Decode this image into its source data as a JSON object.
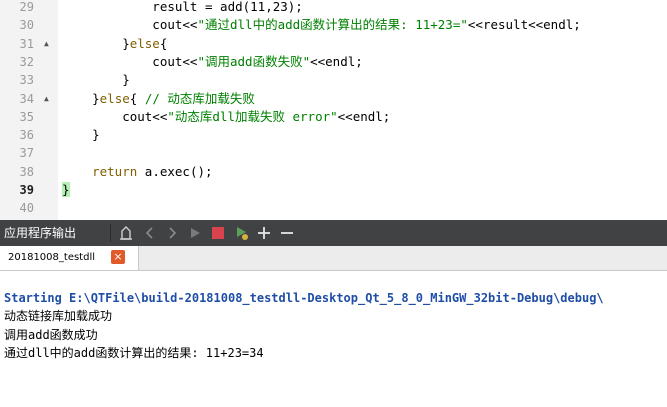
{
  "editor": {
    "lines": [
      {
        "num": "29",
        "code": [
          {
            "t": "            result = add(11,23);",
            "c": ""
          }
        ]
      },
      {
        "num": "30",
        "code": [
          {
            "t": "            cout<<",
            "c": ""
          },
          {
            "t": "\"通过dll中的add函数计算出的结果: 11+23=\"",
            "c": "str"
          },
          {
            "t": "<<result<<endl;",
            "c": ""
          }
        ]
      },
      {
        "num": "31",
        "fold": "▲",
        "code": [
          {
            "t": "        }",
            "c": ""
          },
          {
            "t": "else",
            "c": "kw"
          },
          {
            "t": "{",
            "c": ""
          }
        ]
      },
      {
        "num": "32",
        "code": [
          {
            "t": "            cout<<",
            "c": ""
          },
          {
            "t": "\"调用add函数失败\"",
            "c": "str"
          },
          {
            "t": "<<endl;",
            "c": ""
          }
        ]
      },
      {
        "num": "33",
        "code": [
          {
            "t": "        }",
            "c": ""
          }
        ]
      },
      {
        "num": "34",
        "fold": "▲",
        "code": [
          {
            "t": "    }",
            "c": ""
          },
          {
            "t": "else",
            "c": "kw"
          },
          {
            "t": "{ ",
            "c": ""
          },
          {
            "t": "// 动态库加载失败",
            "c": "cm"
          }
        ]
      },
      {
        "num": "35",
        "code": [
          {
            "t": "        cout<<",
            "c": ""
          },
          {
            "t": "\"动态库dll加载失败 error\"",
            "c": "str"
          },
          {
            "t": "<<endl;",
            "c": ""
          }
        ]
      },
      {
        "num": "36",
        "code": [
          {
            "t": "    }",
            "c": ""
          }
        ]
      },
      {
        "num": "37",
        "code": [
          {
            "t": "",
            "c": ""
          }
        ]
      },
      {
        "num": "38",
        "code": [
          {
            "t": "    ",
            "c": ""
          },
          {
            "t": "return",
            "c": "kw"
          },
          {
            "t": " a.exec();",
            "c": ""
          }
        ]
      },
      {
        "num": "39",
        "current": true,
        "code": [
          {
            "t": "}",
            "c": "brace-hl"
          }
        ]
      },
      {
        "num": "40",
        "code": [
          {
            "t": "",
            "c": ""
          }
        ]
      }
    ]
  },
  "panel": {
    "title": "应用程序输出",
    "toolbar": [
      "attach-icon",
      "prev-arrow-icon",
      "next-arrow-icon",
      "run-icon",
      "stop-icon",
      "debug-icon",
      "zoom-in-icon",
      "zoom-out-icon"
    ]
  },
  "tab": {
    "label": "20181008_testdll",
    "close": "×"
  },
  "output": {
    "lines": [
      {
        "text": "Starting E:\\QTFile\\build-20181008_testdll-Desktop_Qt_5_8_0_MinGW_32bit-Debug\\debug\\",
        "style": "start"
      },
      {
        "text": "动态链接库加载成功",
        "style": "normal"
      },
      {
        "text": "调用add函数成功",
        "style": "normal"
      },
      {
        "text": "通过dll中的add函数计算出的结果: 11+23=34",
        "style": "normal"
      }
    ]
  },
  "colors": {
    "panel_bg": "#404244",
    "start_text": "#1f4ea8",
    "string": "#008000",
    "keyword": "#806000",
    "stop": "#d9434e",
    "run": "#7a7a7a",
    "close_tab": "#e05a2a"
  }
}
